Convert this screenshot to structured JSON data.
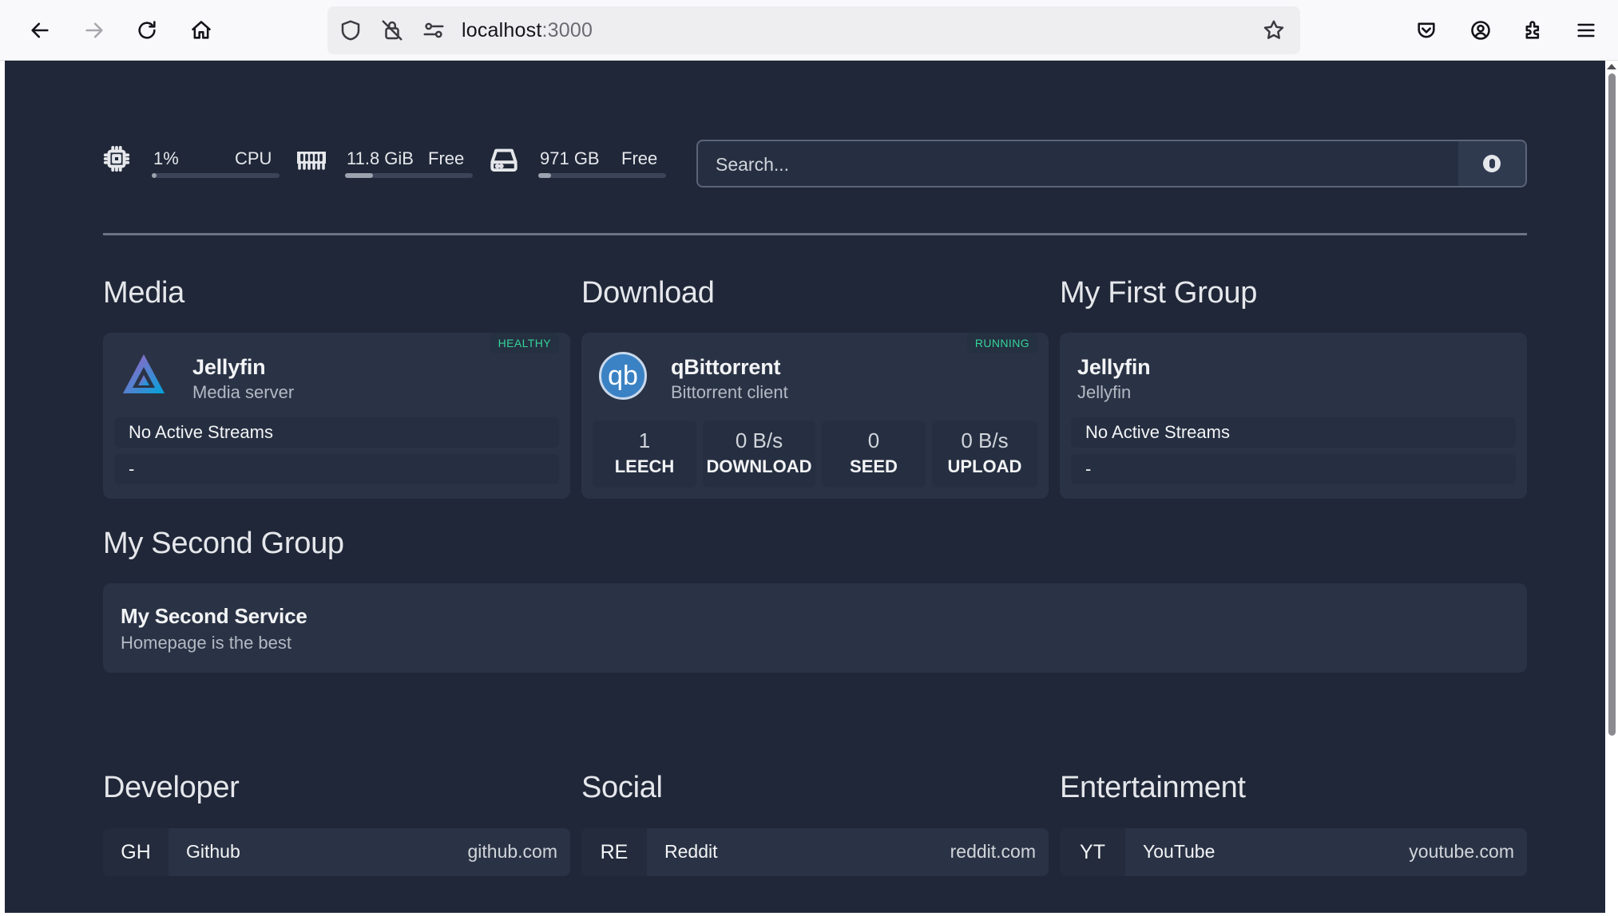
{
  "browser": {
    "url_host": "localhost",
    "url_port": ":3000",
    "icons": [
      "back-arrow-icon",
      "forward-arrow-icon",
      "reload-icon",
      "home-icon",
      "shield-icon",
      "no-tracking-icon",
      "permissions-icon",
      "star-icon",
      "pocket-icon",
      "account-icon",
      "extensions-icon",
      "menu-icon"
    ]
  },
  "widgets": {
    "cpu": {
      "value": "1%",
      "label": "CPU",
      "usage": 0.01
    },
    "memory": {
      "value": "11.8 GiB",
      "label": "Free",
      "usage": 0.22
    },
    "disk": {
      "value": "971 GB",
      "label": "Free",
      "usage": 0.1
    }
  },
  "search": {
    "placeholder": "Search..."
  },
  "groups": {
    "media": {
      "title": "Media",
      "service": {
        "name": "Jellyfin",
        "description": "Media server",
        "status": "HEALTHY",
        "streams": "No Active Streams",
        "stream_detail": "-"
      }
    },
    "download": {
      "title": "Download",
      "service": {
        "name": "qBittorrent",
        "description": "Bittorrent client",
        "status": "RUNNING",
        "icon_text": "qb",
        "stats": [
          {
            "value": "1",
            "label": "LEECH"
          },
          {
            "value": "0 B/s",
            "label": "DOWNLOAD"
          },
          {
            "value": "0",
            "label": "SEED"
          },
          {
            "value": "0 B/s",
            "label": "UPLOAD"
          }
        ]
      }
    },
    "first": {
      "title": "My First Group",
      "service": {
        "name": "Jellyfin",
        "description": "Jellyfin",
        "streams": "No Active Streams",
        "stream_detail": "-"
      }
    },
    "second": {
      "title": "My Second Group",
      "service": {
        "name": "My Second Service",
        "description": "Homepage is the best"
      }
    }
  },
  "bookmarks": [
    {
      "group": "Developer",
      "abbr": "GH",
      "name": "Github",
      "url": "github.com"
    },
    {
      "group": "Social",
      "abbr": "RE",
      "name": "Reddit",
      "url": "reddit.com"
    },
    {
      "group": "Entertainment",
      "abbr": "YT",
      "name": "YouTube",
      "url": "youtube.com"
    }
  ],
  "colors": {
    "background": "#1f2738",
    "card": "#2a3345",
    "status_green": "#34d399",
    "qb_blue": "#3b82c4"
  }
}
